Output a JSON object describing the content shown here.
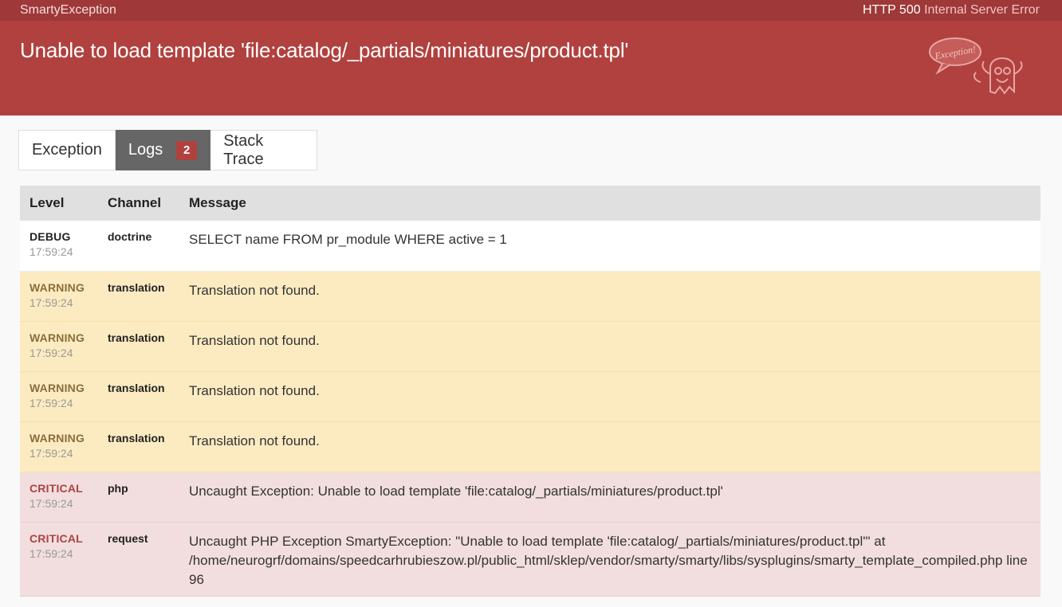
{
  "topbar": {
    "app_name": "SmartyException",
    "status_code": "HTTP 500",
    "status_text": "Internal Server Error"
  },
  "header": {
    "title": "Unable to load template 'file:catalog/_partials/miniatures/product.tpl'",
    "logo_text": "Exception!"
  },
  "tabs": [
    {
      "label": "Exception"
    },
    {
      "label": "Logs",
      "badge": "2"
    },
    {
      "label": "Stack Trace"
    }
  ],
  "table": {
    "headers": [
      "Level",
      "Channel",
      "Message"
    ],
    "rows": [
      {
        "level": "DEBUG",
        "time": "17:59:24",
        "channel": "doctrine",
        "message": "SELECT name FROM pr_module WHERE active = 1"
      },
      {
        "level": "WARNING",
        "time": "17:59:24",
        "channel": "translation",
        "message": "Translation not found."
      },
      {
        "level": "WARNING",
        "time": "17:59:24",
        "channel": "translation",
        "message": "Translation not found."
      },
      {
        "level": "WARNING",
        "time": "17:59:24",
        "channel": "translation",
        "message": "Translation not found."
      },
      {
        "level": "WARNING",
        "time": "17:59:24",
        "channel": "translation",
        "message": "Translation not found."
      },
      {
        "level": "CRITICAL",
        "time": "17:59:24",
        "channel": "php",
        "message": "Uncaught Exception: Unable to load template 'file:catalog/_partials/miniatures/product.tpl'"
      },
      {
        "level": "CRITICAL",
        "time": "17:59:24",
        "channel": "request",
        "message": "Uncaught PHP Exception SmartyException: \"Unable to load template 'file:catalog/_partials/miniatures/product.tpl'\" at /home/neurogrf/domains/speedcarhrubieszow.pl/public_html/sklep/vendor/smarty/smarty/libs/sysplugins/smarty_template_compiled.php line 96"
      }
    ]
  },
  "colors": {
    "topbar": "#9f3838",
    "header": "#b0413e",
    "warning_row": "#fcebc1",
    "critical_row": "#f2dede",
    "active_tab": "#666666"
  }
}
